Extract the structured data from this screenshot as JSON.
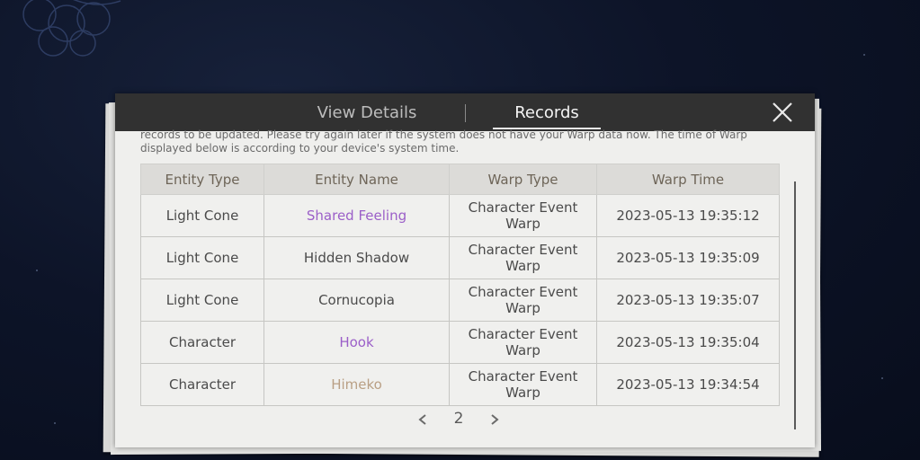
{
  "tabs": [
    {
      "label": "View Details",
      "active": false
    },
    {
      "label": "Records",
      "active": true
    }
  ],
  "notice": {
    "line1": "records to be updated. Please try again later if the system does not have your Warp data now. The time of Warp",
    "line2": "displayed below is according to your device's system time."
  },
  "table": {
    "headers": [
      "Entity Type",
      "Entity Name",
      "Warp Type",
      "Warp Time"
    ],
    "rows": [
      {
        "type": "Light Cone",
        "name": "Shared Feeling",
        "warp": "Character Event Warp",
        "time": "2023-05-13 19:35:12",
        "rarity": 4
      },
      {
        "type": "Light Cone",
        "name": "Hidden Shadow",
        "warp": "Character Event Warp",
        "time": "2023-05-13 19:35:09",
        "rarity": 3
      },
      {
        "type": "Light Cone",
        "name": "Cornucopia",
        "warp": "Character Event Warp",
        "time": "2023-05-13 19:35:07",
        "rarity": 3
      },
      {
        "type": "Character",
        "name": "Hook",
        "warp": "Character Event Warp",
        "time": "2023-05-13 19:35:04",
        "rarity": 4
      },
      {
        "type": "Character",
        "name": "Himeko",
        "warp": "Character Event Warp",
        "time": "2023-05-13 19:34:54",
        "rarity": 5
      }
    ]
  },
  "pager": {
    "page": "2"
  },
  "colors": {
    "rarity4": "#9b5fc8",
    "rarity5": "#b99f84",
    "header_bar": "#313131"
  },
  "icons": {
    "close": "close-icon",
    "prev": "chevron-left-icon",
    "next": "chevron-right-icon"
  }
}
